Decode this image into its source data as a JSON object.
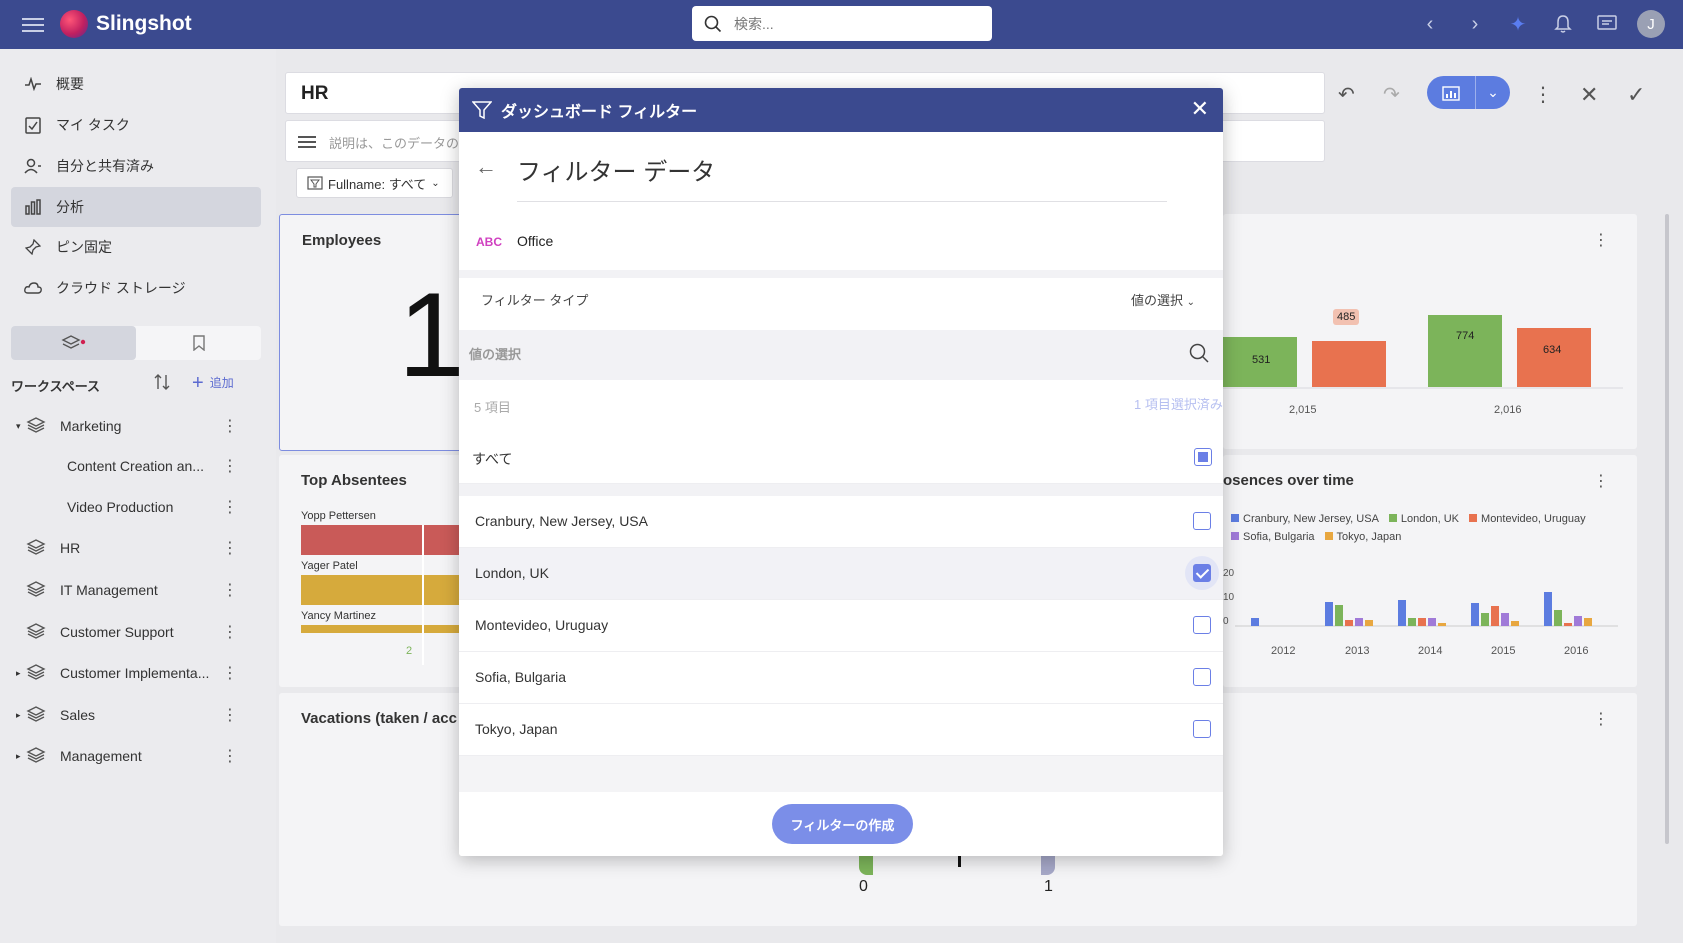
{
  "app": {
    "name": "Slingshot",
    "search_placeholder": "検索...",
    "avatar_initial": "J"
  },
  "sidebar": {
    "nav": [
      {
        "label": "概要",
        "icon": "activity-icon"
      },
      {
        "label": "マイ タスク",
        "icon": "task-icon"
      },
      {
        "label": "自分と共有済み",
        "icon": "shared-user-icon"
      },
      {
        "label": "分析",
        "icon": "analytics-icon",
        "active": true
      },
      {
        "label": "ピン固定",
        "icon": "pin-icon"
      },
      {
        "label": "クラウド ストレージ",
        "icon": "cloud-icon"
      }
    ],
    "workspace_header": "ワークスペース",
    "add_label": "追加",
    "workspaces": [
      {
        "label": "Marketing",
        "expanded": true
      },
      {
        "label": "Content Creation an...",
        "child": true
      },
      {
        "label": "Video Production",
        "child": true
      },
      {
        "label": "HR"
      },
      {
        "label": "IT Management"
      },
      {
        "label": "Customer Support"
      },
      {
        "label": "Customer Implementa...",
        "collapsed": true
      },
      {
        "label": "Sales",
        "collapsed": true
      },
      {
        "label": "Management",
        "collapsed": true
      }
    ]
  },
  "dashboard": {
    "title": "HR",
    "description_placeholder": "説明は、このデータのコン",
    "filter_chip": "Fullname: すべて",
    "cards": {
      "employees": {
        "title": "Employees",
        "value": "1"
      },
      "top_absentees": {
        "title": "Top Absentees",
        "rows": [
          "Yopp Pettersen",
          "Yager Patel",
          "Yancy Martinez"
        ],
        "axis_value": "2"
      },
      "vacations": {
        "title": "Vacations (taken / acc"
      },
      "absences": {
        "title": "osences over time",
        "legend": [
          "Cranbury, New Jersey, USA",
          "London, UK",
          "Montevideo, Uruguay",
          "Sofia, Bulgaria",
          "Tokyo, Japan"
        ],
        "years": [
          "2012",
          "2013",
          "2014",
          "2015",
          "2016"
        ],
        "y_ticks": [
          "20",
          "10",
          "0"
        ]
      },
      "bars_top": {
        "labels": [
          "531",
          "485",
          "774",
          "634"
        ],
        "years": [
          "2,015",
          "2,016"
        ]
      },
      "gauge": {
        "min": "0",
        "max": "1"
      }
    }
  },
  "modal": {
    "title": "ダッシュボード フィルター",
    "subtitle": "フィルター データ",
    "field_type": "ABC",
    "field_name": "Office",
    "filter_type_label": "フィルター タイプ",
    "filter_type_value": "値の選択",
    "value_search_label": "値の選択",
    "count_label": "5 項目",
    "selected_label": "1 項目選択済み",
    "all_label": "すべて",
    "options": [
      {
        "label": "Cranbury, New Jersey, USA",
        "checked": false
      },
      {
        "label": "London, UK",
        "checked": true
      },
      {
        "label": "Montevideo, Uruguay",
        "checked": false
      },
      {
        "label": "Sofia, Bulgaria",
        "checked": false
      },
      {
        "label": "Tokyo, Japan",
        "checked": false
      }
    ],
    "create_button": "フィルターの作成"
  },
  "colors": {
    "header": "#3b4a8f",
    "accent": "#6b7fe6",
    "green": "#7cb45a",
    "orange": "#e8724f",
    "blue": "#5c7ce0"
  }
}
